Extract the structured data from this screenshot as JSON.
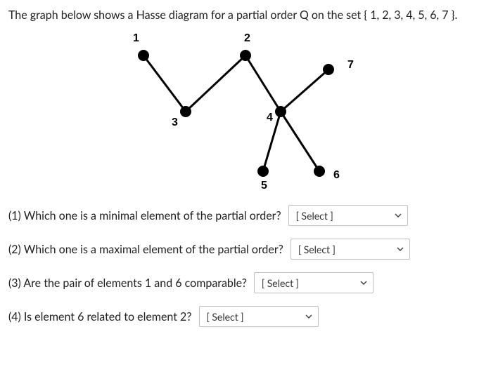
{
  "intro": "The graph below shows a Hasse diagram for a partial order Q on the set { 1, 2, 3, 4, 5, 6, 7 }.",
  "diagram": {
    "labels": {
      "n1": "1",
      "n2": "2",
      "n3": "3",
      "n4": "4",
      "n5": "5",
      "n6": "6",
      "n7": "7"
    }
  },
  "questions": {
    "q1": {
      "text": "(1) Which one is a minimal element of the partial order?",
      "select_placeholder": "[ Select ]",
      "select_width": 170
    },
    "q2": {
      "text": "(2) Which one is a maximal element of the partial order?",
      "select_placeholder": "[ Select ]",
      "select_width": 170
    },
    "q3": {
      "text": "(3) Are the pair of elements 1 and 6 comparable?",
      "select_placeholder": "[ Select ]",
      "select_width": 170
    },
    "q4": {
      "text": "(4) Is element 6 related to element 2?",
      "select_placeholder": "[ Select ]",
      "select_width": 170
    }
  }
}
